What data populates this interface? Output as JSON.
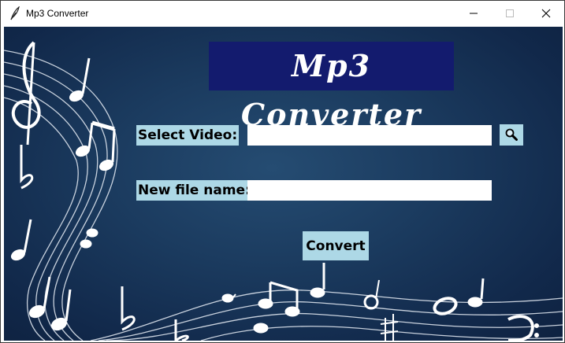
{
  "window": {
    "title": "Mp3 Converter"
  },
  "header": {
    "app_title": "Mp3 Converter"
  },
  "form": {
    "select_video_label": "Select Video:",
    "select_video_value": "",
    "browse_icon": "magnifier-icon",
    "new_file_label": "New file name:",
    "new_file_value": "",
    "convert_label": "Convert"
  },
  "colors": {
    "background": "#1b3b5f",
    "title_bg": "#131b6e",
    "label_bg": "#add8e6",
    "entry_bg": "#ffffff"
  }
}
